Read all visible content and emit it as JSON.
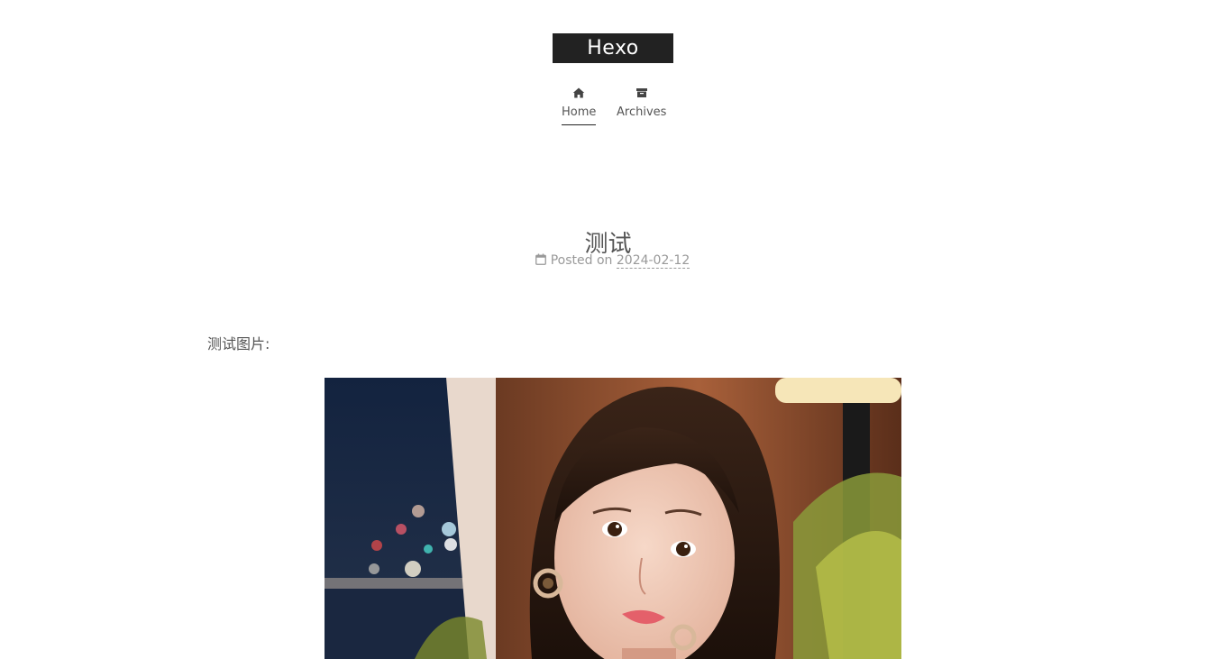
{
  "site": {
    "brand": "Hexo"
  },
  "menu": {
    "items": [
      {
        "label": "Home",
        "icon": "home-icon"
      },
      {
        "label": "Archives",
        "icon": "archive-icon"
      }
    ]
  },
  "post": {
    "title": "测试",
    "meta_prefix": "Posted on",
    "date": "2024-02-12",
    "meta_icon": "calendar-icon",
    "body_text": "测试图片:"
  },
  "colors": {
    "brand_bg": "#222222",
    "text": "#555555",
    "meta": "#999999"
  }
}
